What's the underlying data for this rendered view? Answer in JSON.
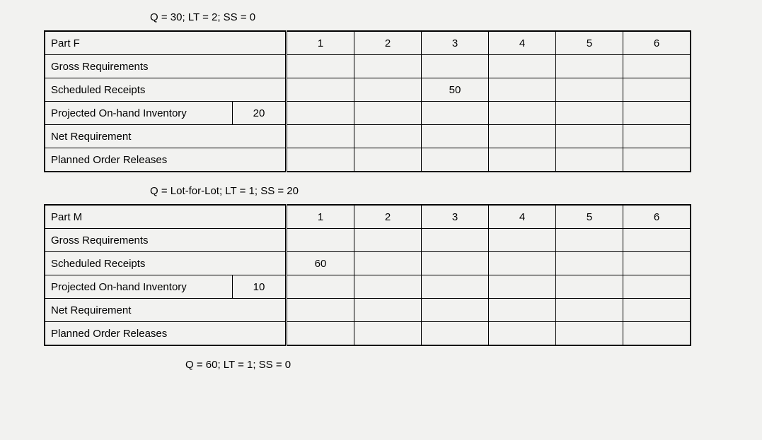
{
  "tables": [
    {
      "params": "Q = 30; LT = 2; SS = 0",
      "title": "Part F",
      "periods": [
        "1",
        "2",
        "3",
        "4",
        "5",
        "6"
      ],
      "rows": [
        {
          "label": "Gross Requirements",
          "init": "",
          "cells": [
            "",
            "",
            "",
            "",
            "",
            ""
          ]
        },
        {
          "label": "Scheduled Receipts",
          "init": "",
          "cells": [
            "",
            "",
            "50",
            "",
            "",
            ""
          ]
        },
        {
          "label": "Projected On-hand Inventory",
          "init": "20",
          "cells": [
            "",
            "",
            "",
            "",
            "",
            ""
          ]
        },
        {
          "label": "Net Requirement",
          "init": "",
          "cells": [
            "",
            "",
            "",
            "",
            "",
            ""
          ]
        },
        {
          "label": "Planned Order Releases",
          "init": "",
          "cells": [
            "",
            "",
            "",
            "",
            "",
            ""
          ]
        }
      ]
    },
    {
      "params": "Q = Lot-for-Lot; LT = 1; SS = 20",
      "title": "Part M",
      "periods": [
        "1",
        "2",
        "3",
        "4",
        "5",
        "6"
      ],
      "rows": [
        {
          "label": "Gross Requirements",
          "init": "",
          "cells": [
            "",
            "",
            "",
            "",
            "",
            ""
          ]
        },
        {
          "label": "Scheduled Receipts",
          "init": "",
          "cells": [
            "60",
            "",
            "",
            "",
            "",
            ""
          ]
        },
        {
          "label": "Projected On-hand Inventory",
          "init": "10",
          "cells": [
            "",
            "",
            "",
            "",
            "",
            ""
          ]
        },
        {
          "label": "Net Requirement",
          "init": "",
          "cells": [
            "",
            "",
            "",
            "",
            "",
            ""
          ]
        },
        {
          "label": "Planned Order Releases",
          "init": "",
          "cells": [
            "",
            "",
            "",
            "",
            "",
            ""
          ]
        }
      ]
    }
  ],
  "trailing_params": "Q = 60; LT = 1; SS = 0"
}
